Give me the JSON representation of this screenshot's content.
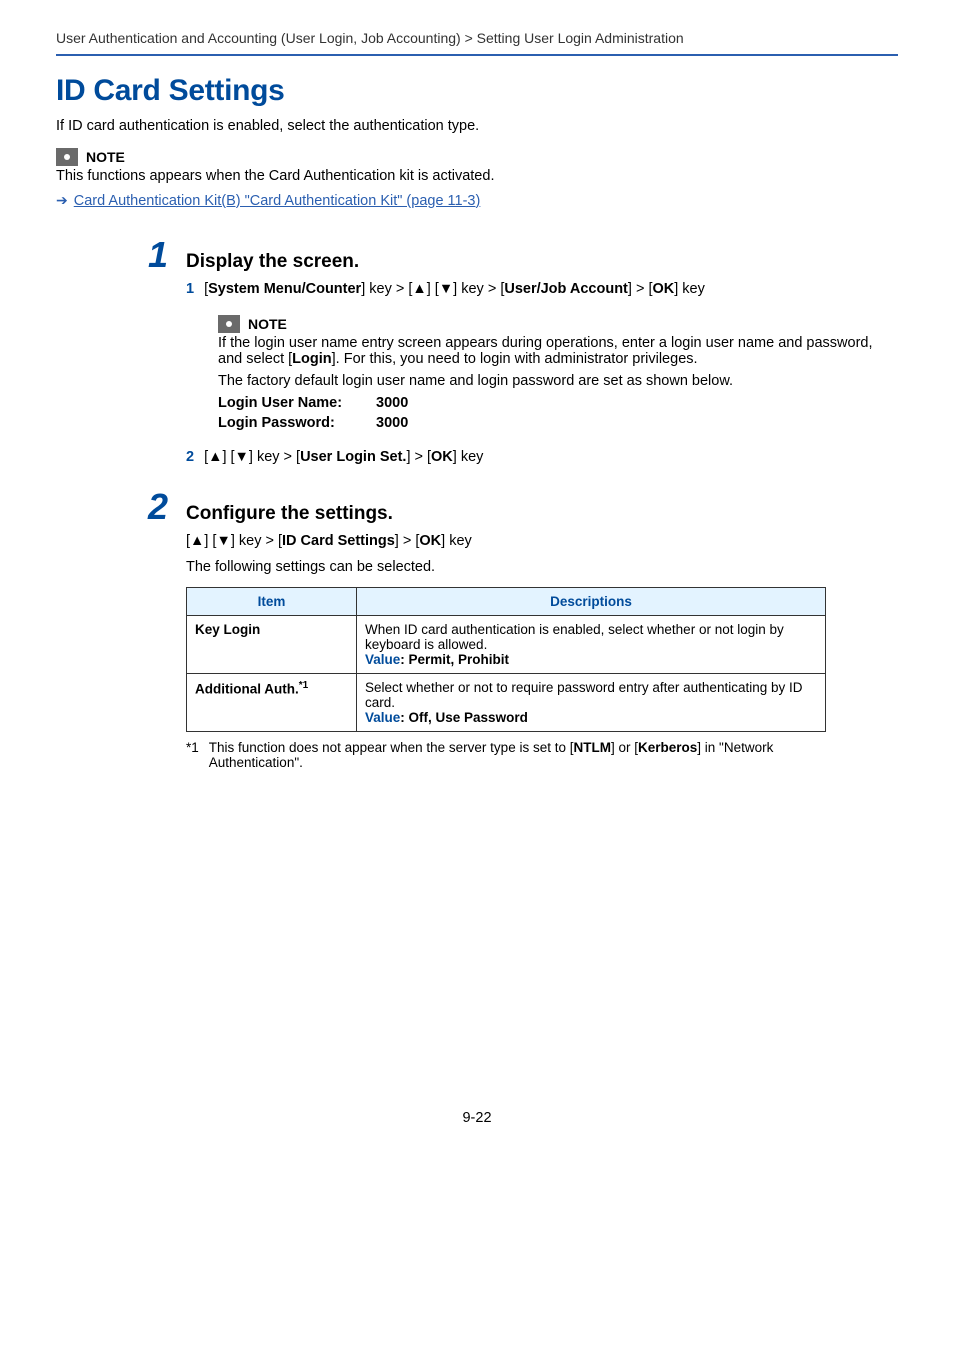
{
  "breadcrumb": "User Authentication and Accounting (User Login, Job Accounting) > Setting User Login Administration",
  "title": "ID Card Settings",
  "intro": "If ID card authentication is enabled, select the authentication type.",
  "note_label": "NOTE",
  "top_note": "This functions appears when the Card Authentication kit is activated.",
  "xref": "Card Authentication Kit(B) \"Card Authentication Kit\" (page 11-3)",
  "step1": {
    "num": "1",
    "title": "Display the screen.",
    "sub1_num": "1",
    "sub1_prefix": "[",
    "sub1_bold1": "System Menu/Counter",
    "sub1_mid1": "] key > [▲] [▼] key > [",
    "sub1_bold2": "User/Job Account",
    "sub1_mid2": "] > [",
    "sub1_bold3": "OK",
    "sub1_suffix": "] key",
    "note_p1_a": "If the login user name entry screen appears during operations, enter a login user name and password, and select [",
    "note_p1_b": "Login",
    "note_p1_c": "]. For this, you need to login with administrator privileges.",
    "note_p2": "The factory default login user name and login password are set as shown below.",
    "cred_user_label": "Login User Name:",
    "cred_user_value": "3000",
    "cred_pass_label": "Login Password:",
    "cred_pass_value": "3000",
    "sub2_num": "2",
    "sub2_a": "[▲] [▼] key > [",
    "sub2_b": "User Login Set.",
    "sub2_c": "] > [",
    "sub2_d": "OK",
    "sub2_e": "] key"
  },
  "step2": {
    "num": "2",
    "title": "Configure the settings.",
    "line1_a": "[▲] [▼] key > [",
    "line1_b": "ID Card Settings",
    "line1_c": "] > [",
    "line1_d": "OK",
    "line1_e": "] key",
    "line2": "The following settings can be selected.",
    "th_item": "Item",
    "th_desc": "Descriptions",
    "row1_item": "Key Login",
    "row1_desc": "When ID card authentication is enabled, select whether or not login by keyboard is allowed.",
    "row1_value_label": "Value",
    "row1_value": ": Permit, Prohibit",
    "row2_item": "Additional Auth.",
    "row2_sup": "*1",
    "row2_desc": "Select whether or not to require password entry after authenticating by ID card.",
    "row2_value_label": "Value",
    "row2_value": ": Off, Use Password",
    "footnote_mark": "*1",
    "footnote_a": "This function does not appear when the server type is set to [",
    "footnote_b": "NTLM",
    "footnote_c": "] or [",
    "footnote_d": "Kerberos",
    "footnote_e": "] in \"Network Authentication\"."
  },
  "page_num": "9-22"
}
